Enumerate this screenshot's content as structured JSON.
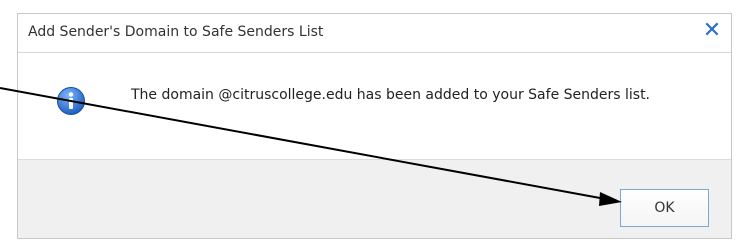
{
  "dialog": {
    "title": "Add Sender's Domain to Safe Senders List",
    "close_icon": "close-icon",
    "info_icon": "info-icon",
    "message": "The domain @citruscollege.edu has been added to your Safe Senders list.",
    "ok_label": "OK"
  },
  "colors": {
    "accent": "#2a6fc2",
    "footer_bg": "#f0f0f0",
    "annotation_arrow": "#000000"
  }
}
